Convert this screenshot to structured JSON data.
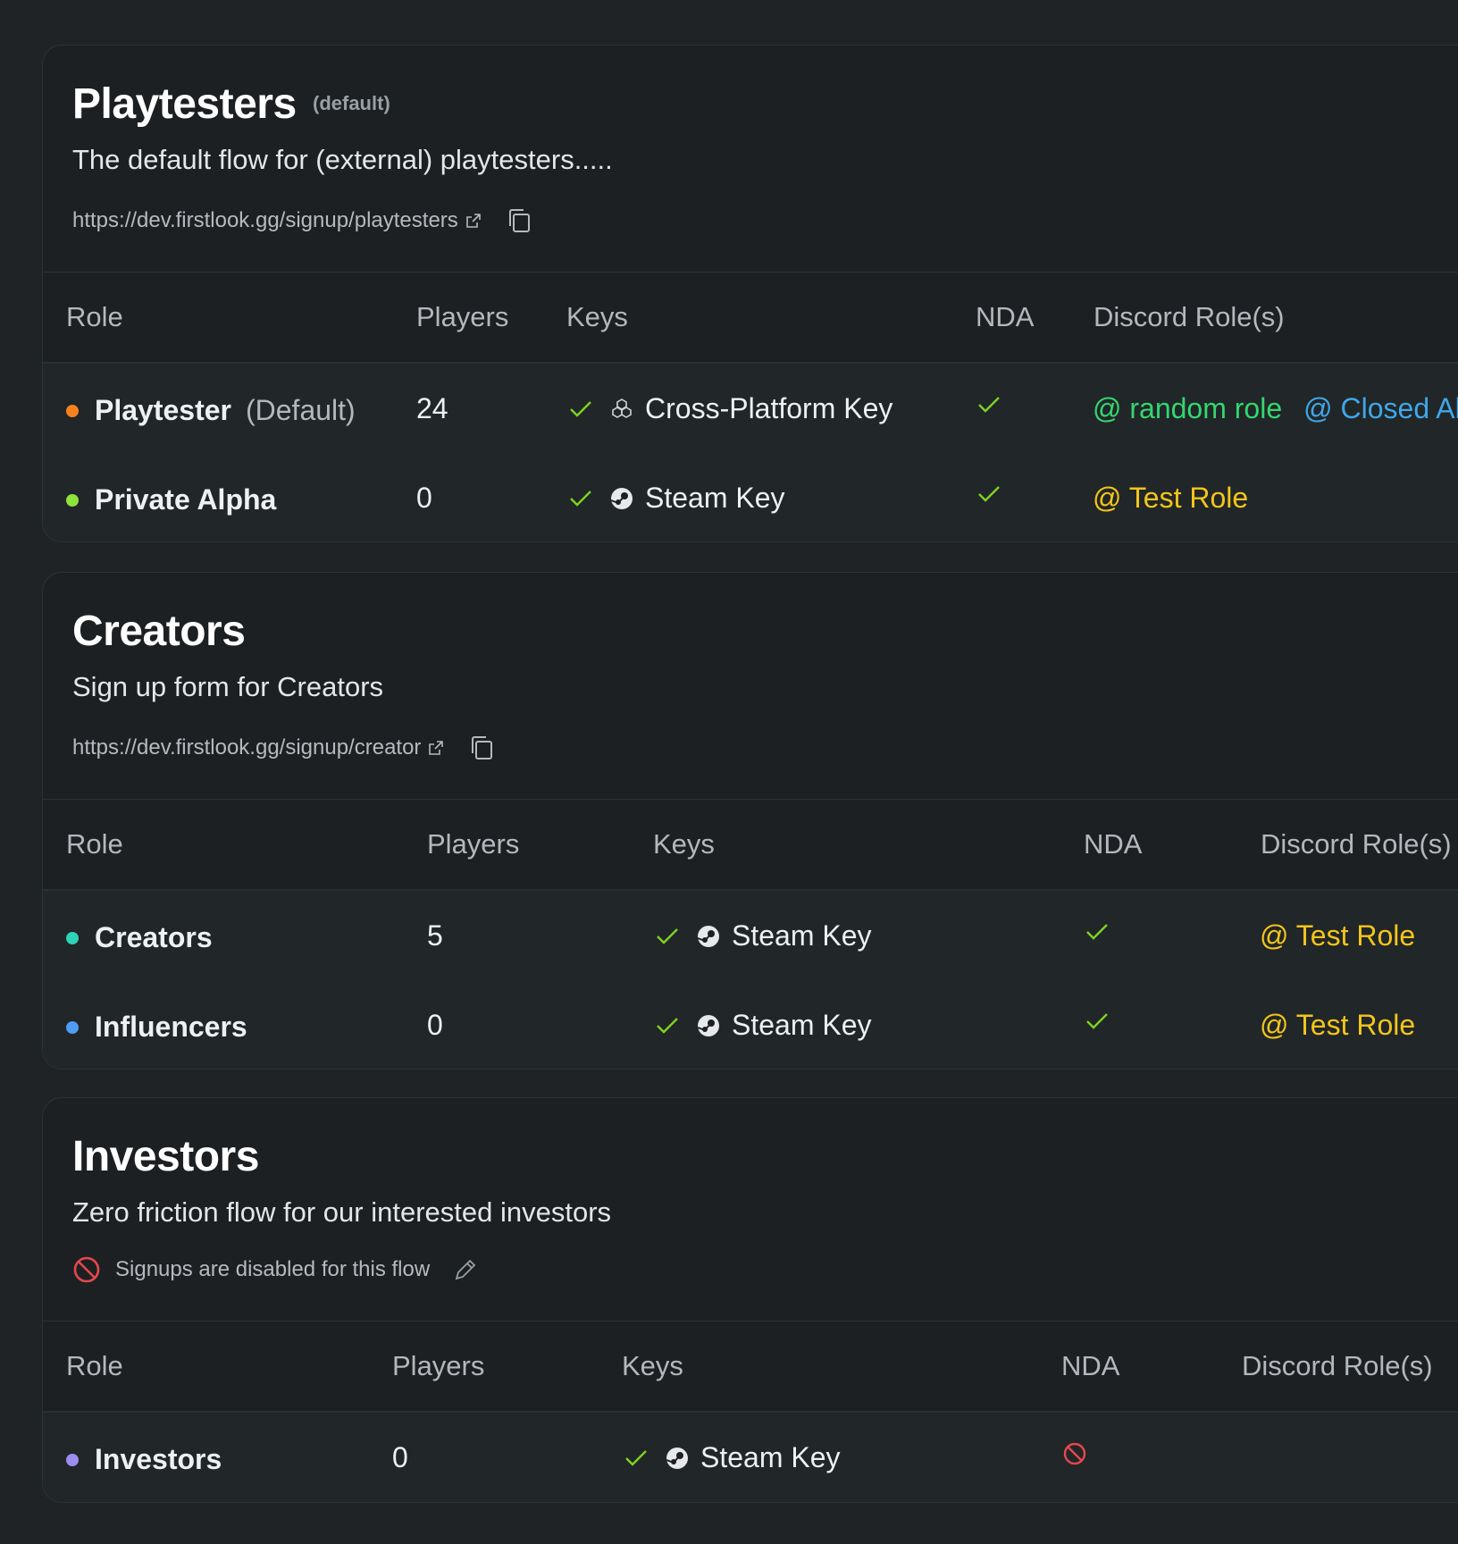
{
  "colors": {
    "background": "#1f2325",
    "check_green": "#7ed321",
    "ban_red": "#e5484d"
  },
  "flows": [
    {
      "title": "Playtesters",
      "badge": "(default)",
      "description": "The default flow for (external) playtesters.....",
      "url": "https://dev.firstlook.gg/signup/playtesters",
      "headers": [
        "Role",
        "Players",
        "Keys",
        "NDA",
        "Discord Role(s)"
      ],
      "rows": [
        {
          "role": "Playtester",
          "role_note": "(Default)",
          "dot_color": "#f5821f",
          "players": "24",
          "key": "Cross-Platform Key",
          "key_icon": "cube-icon",
          "nda": "check",
          "discord": [
            {
              "text": "@ random role",
              "color": "#34d670"
            },
            {
              "text": "@ Closed Al",
              "color": "#3fa7e8"
            }
          ]
        },
        {
          "role": "Private Alpha",
          "role_note": "",
          "dot_color": "#8ee23a",
          "players": "0",
          "key": "Steam Key",
          "key_icon": "steam-icon",
          "nda": "check",
          "discord": [
            {
              "text": "@ Test Role",
              "color": "#f3c51b"
            }
          ]
        }
      ]
    },
    {
      "title": "Creators",
      "badge": "",
      "description": "Sign up form for Creators",
      "url": "https://dev.firstlook.gg/signup/creator",
      "headers": [
        "Role",
        "Players",
        "Keys",
        "NDA",
        "Discord Role(s)"
      ],
      "rows": [
        {
          "role": "Creators",
          "role_note": "",
          "dot_color": "#2ed3b7",
          "players": "5",
          "key": "Steam Key",
          "key_icon": "steam-icon",
          "nda": "check",
          "discord": [
            {
              "text": "@ Test Role",
              "color": "#f3c51b"
            }
          ]
        },
        {
          "role": "Influencers",
          "role_note": "",
          "dot_color": "#4e9cf5",
          "players": "0",
          "key": "Steam Key",
          "key_icon": "steam-icon",
          "nda": "check",
          "discord": [
            {
              "text": "@ Test Role",
              "color": "#f3c51b"
            }
          ]
        }
      ]
    },
    {
      "title": "Investors",
      "badge": "",
      "description": "Zero friction flow for our interested investors",
      "disabled_text": "Signups are disabled for this flow",
      "headers": [
        "Role",
        "Players",
        "Keys",
        "NDA",
        "Discord Role(s)"
      ],
      "rows": [
        {
          "role": "Investors",
          "role_note": "",
          "dot_color": "#9b8cf0",
          "players": "0",
          "key": "Steam Key",
          "key_icon": "steam-icon",
          "nda": "ban",
          "discord": []
        }
      ]
    }
  ]
}
